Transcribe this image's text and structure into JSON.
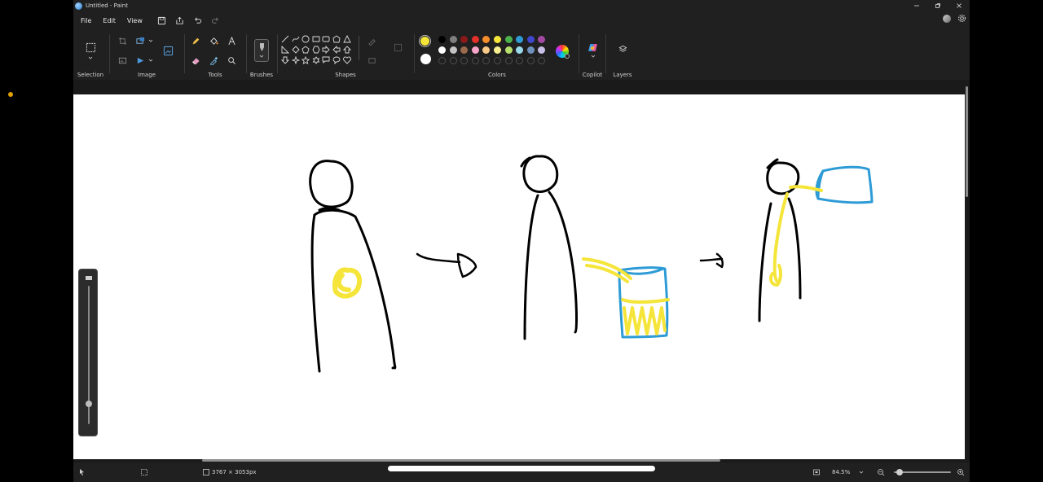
{
  "window": {
    "title": "Untitled - Paint",
    "controls": [
      "minimize",
      "maximize",
      "close"
    ]
  },
  "menu": {
    "items": [
      "File",
      "Edit",
      "View"
    ],
    "quick_access": [
      "save-icon",
      "share-icon",
      "undo-icon",
      "redo-icon"
    ]
  },
  "ribbon": {
    "groups": {
      "selection": "Selection",
      "image": "Image",
      "tools": "Tools",
      "brushes": "Brushes",
      "shapes": "Shapes",
      "colors": "Colors",
      "copilot": "Copilot",
      "layers": "Layers"
    },
    "primary_color": "#f5e53a",
    "secondary_color": "#ffffff",
    "palette_row1": [
      "#000000",
      "#7f7f7f",
      "#8b1a1a",
      "#e2302a",
      "#f58d2a",
      "#f5e53a",
      "#4cb24c",
      "#2f9bd5",
      "#3f48cc",
      "#a349a4"
    ],
    "palette_row2": [
      "#ffffff",
      "#c3c3c3",
      "#9c6b4e",
      "#f7a6c9",
      "#f9c98a",
      "#f7ee8f",
      "#b5e06e",
      "#99d9ea",
      "#7092be",
      "#c8bfe7"
    ]
  },
  "status": {
    "canvas_size": "3767 × 3053px",
    "zoom": "84.5%",
    "zoom_level_fraction": 0.12
  },
  "canvas": {
    "description_free": true
  }
}
